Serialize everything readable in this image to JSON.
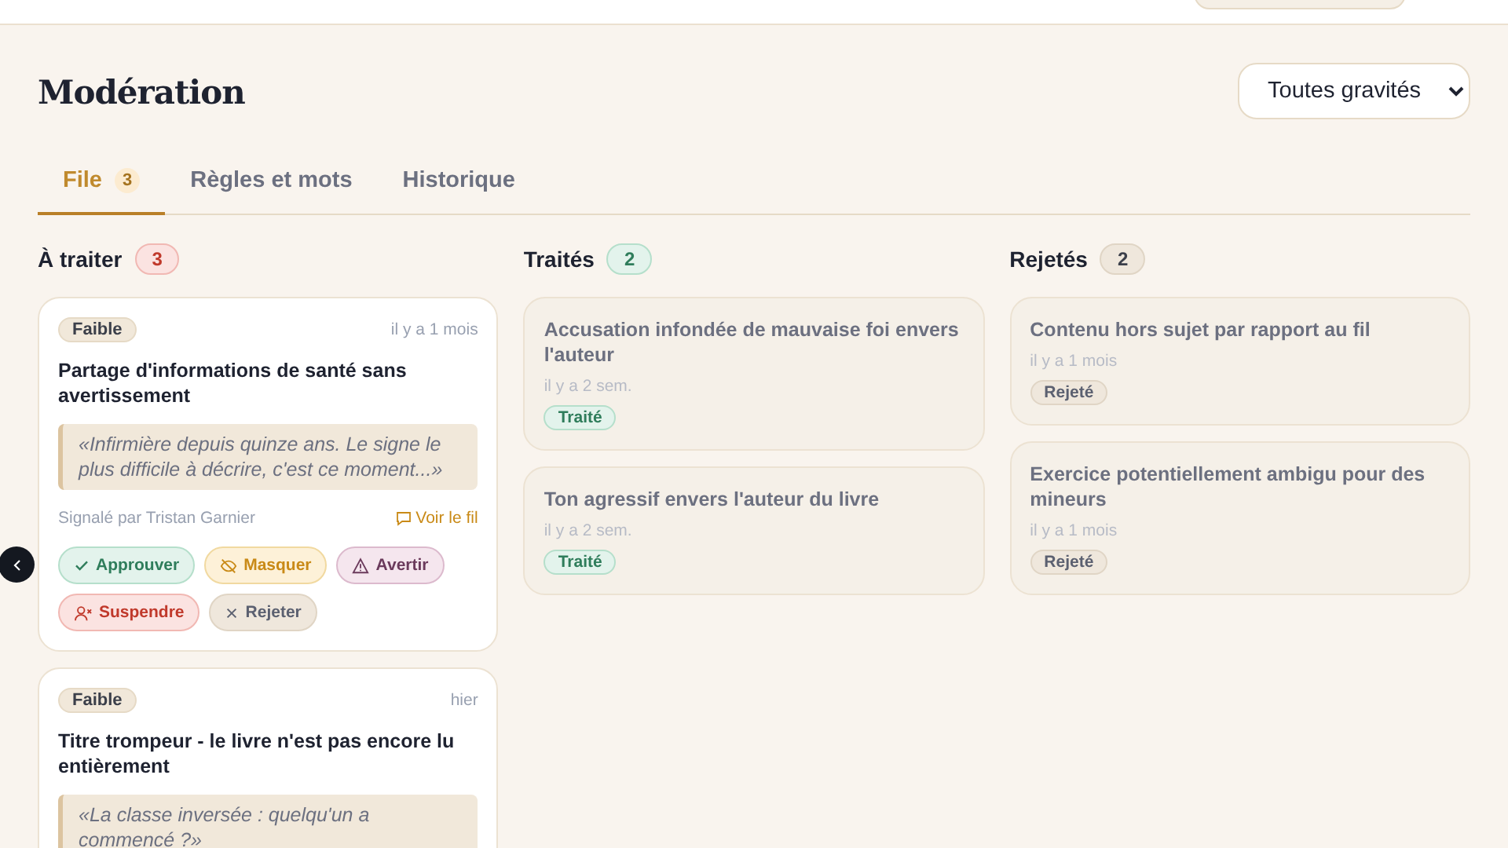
{
  "header": {
    "title": "Modération",
    "filter": {
      "value": "Toutes gravités"
    }
  },
  "tabs": [
    {
      "label": "File",
      "count": "3",
      "selected": true
    },
    {
      "label": "Règles et mots",
      "selected": false
    },
    {
      "label": "Historique",
      "selected": false
    }
  ],
  "columns": [
    {
      "title": "À traiter",
      "count": "3",
      "kind": "pending",
      "cards": [
        {
          "kind": "open",
          "severity": "Faible",
          "time": "il y a 1 mois",
          "title": "Partage d'informations de santé sans avertissement",
          "quote": "«Infirmière depuis quinze ans. Le signe le plus difficile à décrire, c'est ce moment...»",
          "reporter": "Signalé par Tristan Garnier",
          "link": "Voir le fil",
          "actions": [
            {
              "label": "Approuver",
              "kind": "approve"
            },
            {
              "label": "Masquer",
              "kind": "hide"
            },
            {
              "label": "Avertir",
              "kind": "warn"
            },
            {
              "label": "Suspendre",
              "kind": "suspend"
            },
            {
              "label": "Rejeter",
              "kind": "reject"
            }
          ]
        },
        {
          "kind": "open",
          "severity": "Faible",
          "time": "hier",
          "title": "Titre trompeur - le livre n'est pas encore lu entièrement",
          "quote": "«La classe inversée : quelqu'un a commencé ?»"
        }
      ]
    },
    {
      "title": "Traités",
      "count": "2",
      "kind": "done",
      "cards": [
        {
          "kind": "closed",
          "title": "Accusation infondée de mauvaise foi envers l'auteur",
          "time": "il y a 2 sem.",
          "status": "Traité"
        },
        {
          "kind": "closed",
          "title": "Ton agressif envers l'auteur du livre",
          "time": "il y a 2 sem.",
          "status": "Traité"
        }
      ]
    },
    {
      "title": "Rejetés",
      "count": "2",
      "kind": "rejected",
      "cards": [
        {
          "kind": "closed",
          "title": "Contenu hors sujet par rapport au fil",
          "time": "il y a 1 mois",
          "status": "Rejeté"
        },
        {
          "kind": "closed",
          "title": "Exercice potentiellement ambigu pour des mineurs",
          "time": "il y a 1 mois",
          "status": "Rejeté"
        }
      ]
    }
  ]
}
